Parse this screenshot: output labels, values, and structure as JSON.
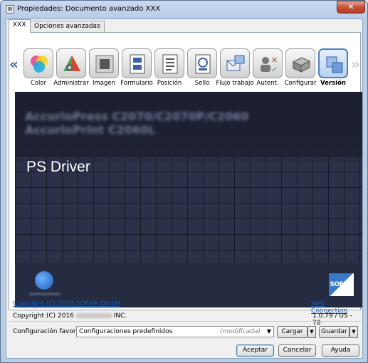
{
  "window": {
    "title": "Propiedades: Documento avanzado XXX",
    "close_glyph": "✕"
  },
  "tabs": [
    {
      "label": "XXX",
      "active": true
    },
    {
      "label": "Opciones avanzadas",
      "active": false
    }
  ],
  "toolbar": {
    "prev_glyph": "«",
    "next_glyph": "»",
    "items": [
      {
        "label": "Color",
        "icon": "color-icon"
      },
      {
        "label": "Administrar",
        "icon": "administrar-icon"
      },
      {
        "label": "Imagen",
        "icon": "imagen-icon"
      },
      {
        "label": "Formulario",
        "icon": "formulario-icon"
      },
      {
        "label": "Posición",
        "icon": "posicion-icon"
      },
      {
        "label": "Sello",
        "icon": "sello-icon"
      },
      {
        "label": "Flujo trabajo",
        "icon": "flujo-trabajo-icon"
      },
      {
        "label": "Autent.",
        "icon": "autent-icon"
      },
      {
        "label": "Configurar",
        "icon": "configurar-icon"
      },
      {
        "label": "Versión",
        "icon": "version-icon",
        "selected": true
      }
    ]
  },
  "banner": {
    "product_line_1": "AccurioPress C2070/C2070P/C2060",
    "product_line_2": "AccurioPrint C2060L",
    "driver_name": "PS Driver",
    "partner_logo": "SOFHA"
  },
  "info": {
    "copyright_link": "Copyright (C) 2016 SOFHA GmbH",
    "web_connection": "Web Connection",
    "copyright_text_prefix": "Copyright (C) 2016",
    "copyright_text_suffix": "INC.",
    "version": "1.0.79 / US - 78"
  },
  "favorites": {
    "label": "Configuración favorita",
    "selected_value": "Configuraciones predefinidos",
    "modified_tag": "(modificada)",
    "load_button": "Cargar",
    "save_button": "Guardar"
  },
  "footer": {
    "ok_button": "Aceptar",
    "cancel_button": "Cancelar",
    "help_button": "Ayuda"
  },
  "colors": {
    "accent": "#3d6aa8",
    "link": "#1d5eb0",
    "banner_bg": "#1d2132"
  }
}
